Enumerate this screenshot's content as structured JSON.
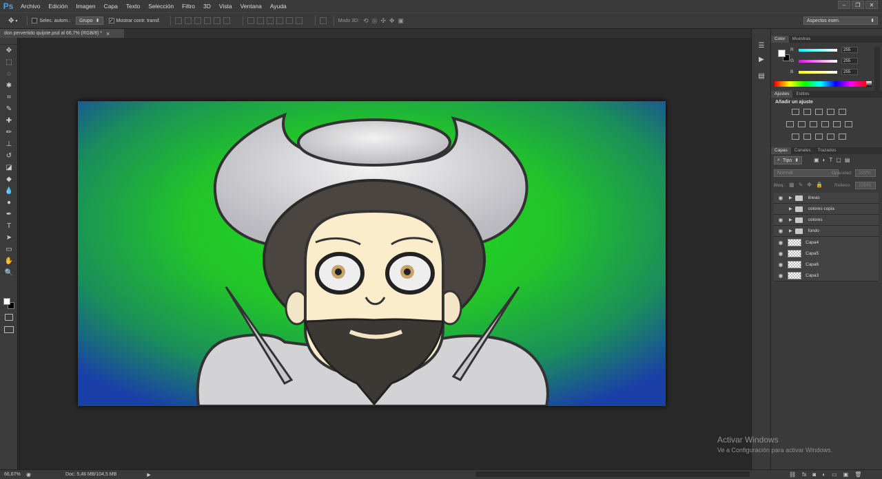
{
  "menu": {
    "logo": "Ps",
    "items": [
      "Archivo",
      "Edición",
      "Imagen",
      "Capa",
      "Texto",
      "Selección",
      "Filtro",
      "3D",
      "Vista",
      "Ventana",
      "Ayuda"
    ]
  },
  "window_controls": [
    "–",
    "❐",
    "✕"
  ],
  "options": {
    "auto_select_label": "Selec. autom.:",
    "auto_select_value": "Grupo",
    "show_transform_label": "Mostrar contr. transf.",
    "mode3d_label": "Modo 3D:",
    "workspace": "Aspectos esen."
  },
  "document_tab": {
    "title": "don pervertido quijote.psd al 66,7% (RGB/8) *",
    "close": "×"
  },
  "statusbar": {
    "zoom": "66,67%",
    "doc_info": "Doc: 5,48 MB/104,5 MB"
  },
  "color_panel": {
    "tabs": [
      "Color",
      "Muestras"
    ],
    "r": {
      "label": "R",
      "value": "255"
    },
    "g": {
      "label": "G",
      "value": "255"
    },
    "b": {
      "label": "B",
      "value": "255"
    }
  },
  "adjustments_panel": {
    "tabs": [
      "Ajustes",
      "Estilos"
    ],
    "heading": "Añadir un ajuste"
  },
  "layers_panel": {
    "tabs": [
      "Capas",
      "Canales",
      "Trazados"
    ],
    "filter_kind": "Tipo",
    "blend_mode": "Normal",
    "opacity_label": "Opacidad:",
    "opacity_value": "100%",
    "lock_label": "Bloq.:",
    "fill_label": "Relleno:",
    "fill_value": "100%",
    "layers": [
      {
        "name": "lineas",
        "type": "group",
        "visible": true
      },
      {
        "name": "colores copia",
        "type": "group",
        "visible": false
      },
      {
        "name": "colores",
        "type": "group",
        "visible": true
      },
      {
        "name": "fondo",
        "type": "group",
        "visible": true
      },
      {
        "name": "Capa4",
        "type": "layer",
        "visible": true
      },
      {
        "name": "Capa5",
        "type": "layer",
        "visible": true
      },
      {
        "name": "Capa6",
        "type": "layer",
        "visible": true
      },
      {
        "name": "Capa3",
        "type": "layer",
        "visible": true
      }
    ]
  },
  "watermark": {
    "title": "Activar Windows",
    "subtitle": "Ve a Configuración para activar Windows."
  },
  "icons": {
    "tools": [
      "move-icon",
      "marquee-icon",
      "lasso-icon",
      "quick-select-icon",
      "crop-icon",
      "eyedropper-icon",
      "healing-brush-icon",
      "brush-icon",
      "clone-stamp-icon",
      "history-brush-icon",
      "eraser-icon",
      "paint-bucket-icon",
      "blur-icon",
      "dodge-icon",
      "pen-icon",
      "type-icon",
      "path-select-icon",
      "rectangle-shape-icon",
      "hand-icon",
      "zoom-icon"
    ],
    "tool_glyphs": [
      "✥",
      "⬚",
      "◌",
      "✱",
      "⌗",
      "✎",
      "✚",
      "✏",
      "⊥",
      "↺",
      "◪",
      "◆",
      "💧",
      "●",
      "✒",
      "T",
      "➤",
      "▭",
      "✋",
      "🔍"
    ]
  }
}
